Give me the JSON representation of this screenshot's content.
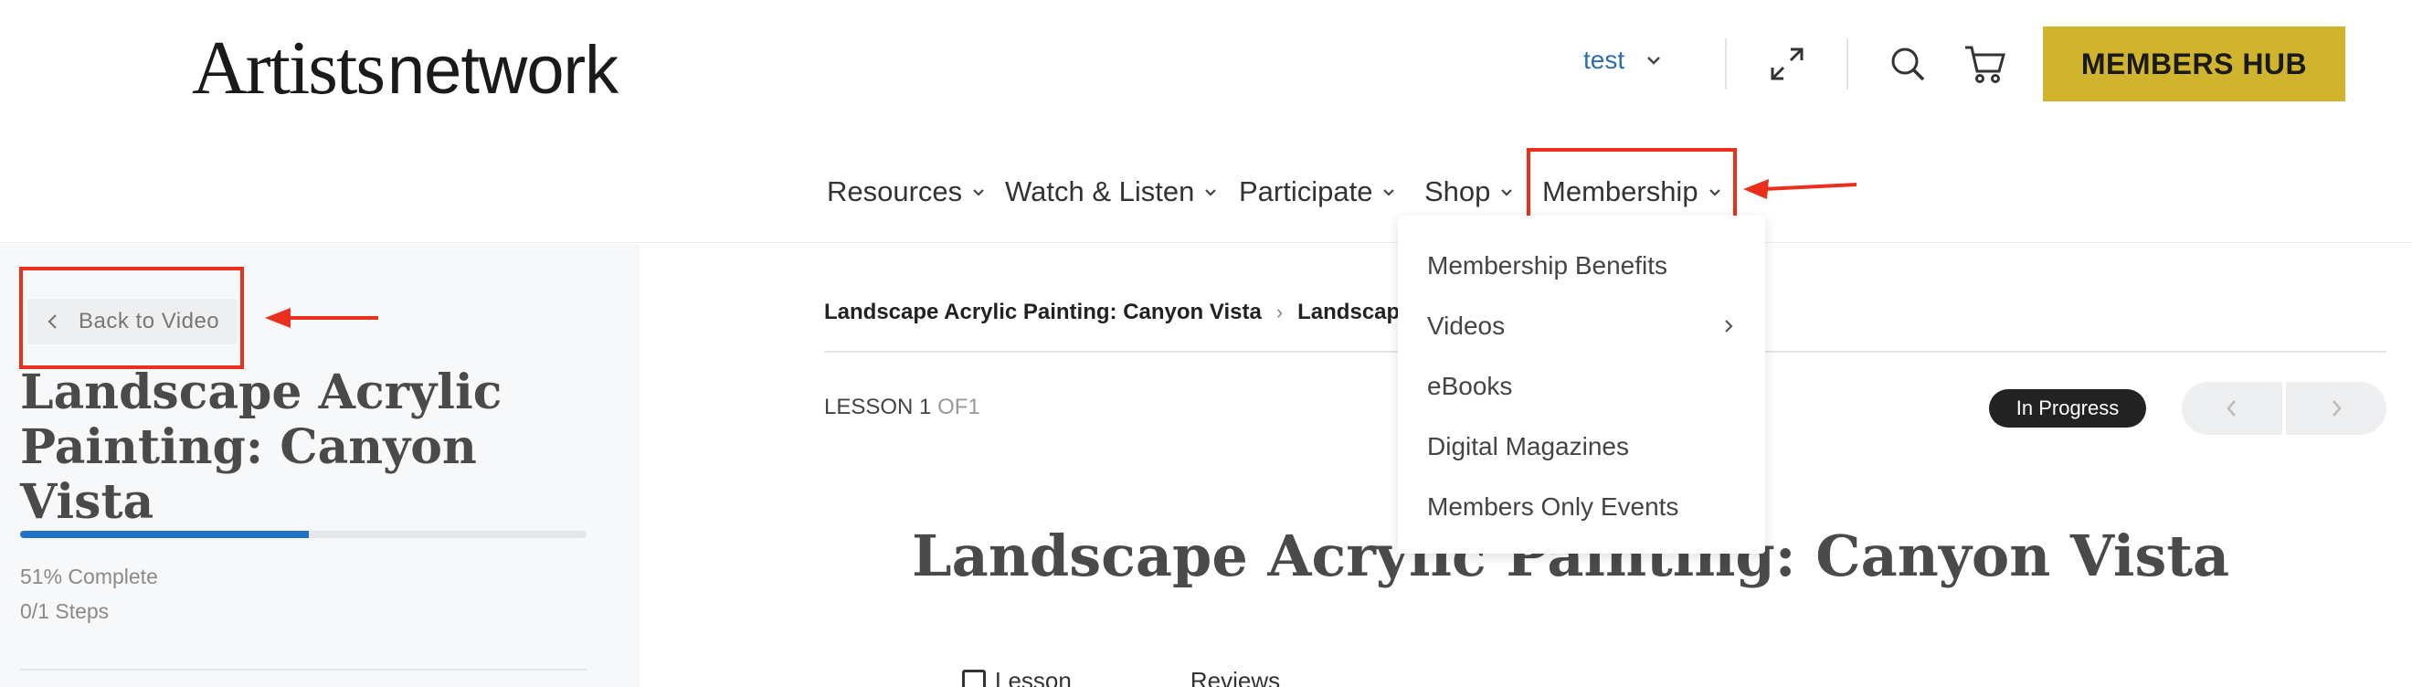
{
  "brand": {
    "logo_part1": "Artists",
    "logo_part2": "network"
  },
  "header": {
    "user_label": "test",
    "members_hub_label": "MEMBERS HUB"
  },
  "nav": {
    "items": [
      {
        "label": "Resources"
      },
      {
        "label": "Watch & Listen"
      },
      {
        "label": "Participate"
      },
      {
        "label": "Shop"
      },
      {
        "label": "Membership"
      }
    ]
  },
  "membership_dropdown": {
    "items": [
      {
        "label": "Membership Benefits"
      },
      {
        "label": "Videos"
      },
      {
        "label": "eBooks"
      },
      {
        "label": "Digital Magazines"
      },
      {
        "label": "Members Only Events"
      }
    ]
  },
  "sidebar": {
    "back_label": "Back to Video",
    "course_title": "Landscape Acrylic Painting: Canyon Vista",
    "progress_fraction": 0.51,
    "percent_complete": "51% Complete",
    "steps": "0/1 Steps"
  },
  "main": {
    "breadcrumb": [
      "Landscape Acrylic Painting: Canyon Vista",
      "Landscape"
    ],
    "lesson_label": "LESSON 1",
    "lesson_of": "OF1",
    "status": "In Progress",
    "title": "Landscape Acrylic Painting: Canyon Vista",
    "tabs": [
      {
        "label": "Lesson"
      },
      {
        "label": "Reviews"
      }
    ]
  },
  "colors": {
    "accent_gold": "#d1b42e",
    "link_blue": "#2a6db5",
    "progress_blue": "#1f72c4",
    "annotation_red": "#e8301c"
  }
}
